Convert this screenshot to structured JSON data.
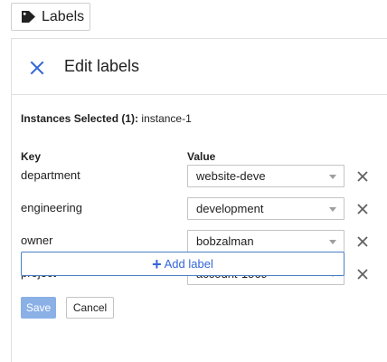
{
  "labels_button": {
    "label": "Labels",
    "icon": "tag-icon"
  },
  "panel": {
    "title": "Edit labels",
    "close_icon": "close-icon",
    "accent_color": "#3367d6",
    "selected_prefix": "Instances Selected (1):",
    "selected_value": " instance-1"
  },
  "table": {
    "key_header": "Key",
    "value_header": "Value",
    "rows": [
      {
        "key": "department",
        "value": "website-deve"
      },
      {
        "key": "engineering",
        "value": "development"
      },
      {
        "key": "owner",
        "value": "bobzalman"
      },
      {
        "key": "project",
        "value": "account-1569"
      }
    ]
  },
  "actions": {
    "add_label": "Add label",
    "save": "Save",
    "cancel": "Cancel"
  }
}
